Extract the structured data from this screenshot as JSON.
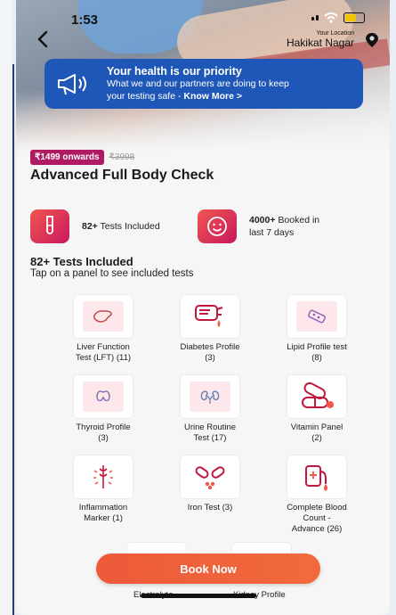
{
  "status_bar": {
    "time": "1:53"
  },
  "location": {
    "label": "Your Location",
    "value": "Hakikat Nagar"
  },
  "banner": {
    "title": "Your health is our priority",
    "line": "What we and our partners are doing to keep",
    "line2": "your testing safe - ",
    "link": "Know More >"
  },
  "package": {
    "price": "₹1499 onwards",
    "original_price": "₹3998",
    "title": "Advanced Full Body Check"
  },
  "features": [
    {
      "bold": "82+",
      "text": " Tests Included"
    },
    {
      "bold": "4000+",
      "text": " Booked in",
      "text2": "last 7 days"
    }
  ],
  "tests_section": {
    "title": "82+ Tests Included",
    "subtitle": "Tap on a panel to see included tests"
  },
  "panels": [
    {
      "l1": "Liver Function",
      "l2": "Test (LFT) (11)",
      "l3": "",
      "icon": "liver-icon"
    },
    {
      "l1": "Diabetes Profile",
      "l2": "(3)",
      "l3": "",
      "icon": "glucometer-icon"
    },
    {
      "l1": "Lipid Profile test",
      "l2": "(8)",
      "l3": "",
      "icon": "pill-strip-icon"
    },
    {
      "l1": "Thyroid Profile",
      "l2": "(3)",
      "l3": "",
      "icon": "thyroid-icon"
    },
    {
      "l1": "Urine Routine",
      "l2": "Test (17)",
      "l3": "",
      "icon": "kidneys-icon"
    },
    {
      "l1": "Vitamin Panel",
      "l2": "(2)",
      "l3": "",
      "icon": "capsules-icon"
    },
    {
      "l1": "Inflammation",
      "l2": "Marker (1)",
      "l3": "",
      "icon": "inflammation-icon"
    },
    {
      "l1": "Iron Test  (3)",
      "l2": "",
      "l3": "",
      "icon": "iron-pills-icon"
    },
    {
      "l1": "Complete Blood",
      "l2": "Count -",
      "l3": "Advance (26)",
      "icon": "blood-bag-icon"
    }
  ],
  "peek_labels": [
    "Electrolyte",
    "Kidney Profile"
  ],
  "cta": {
    "label": "Book Now"
  },
  "colors": {
    "accent": "#ec5a3a",
    "banner": "#1f57b8",
    "price_pill": "#b01a62",
    "icon_bg": "#fde7ea"
  }
}
